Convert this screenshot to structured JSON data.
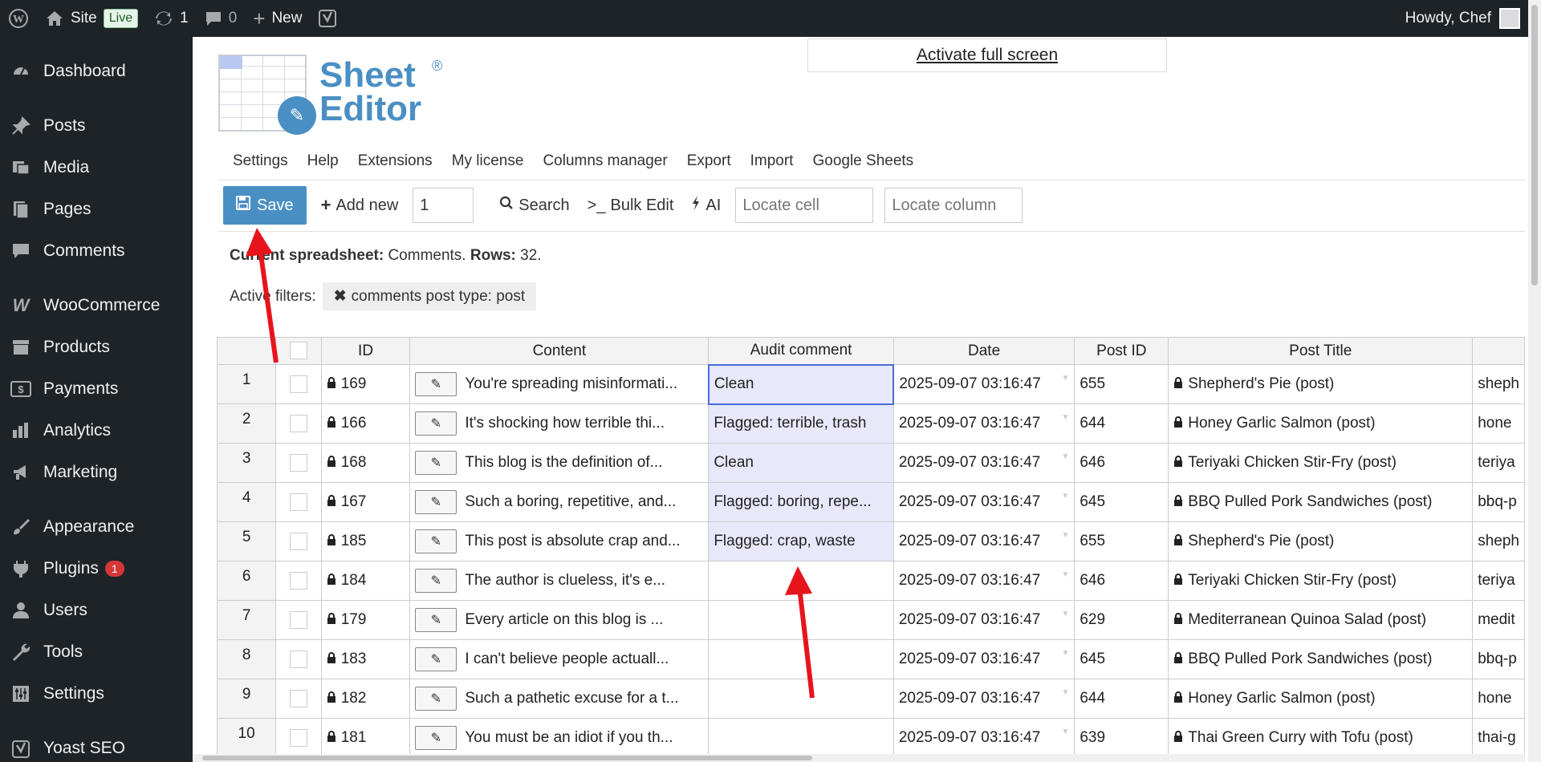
{
  "adminbar": {
    "site_label": "Site",
    "live_label": "Live",
    "updates_count": "1",
    "comments_count": "0",
    "new_label": "New",
    "howdy": "Howdy, Chef"
  },
  "sidebar": {
    "items": [
      {
        "label": "Dashboard",
        "icon": "dashboard-icon"
      },
      {
        "label": "Posts",
        "icon": "pin-icon"
      },
      {
        "label": "Media",
        "icon": "media-icon"
      },
      {
        "label": "Pages",
        "icon": "pages-icon"
      },
      {
        "label": "Comments",
        "icon": "comment-icon"
      },
      {
        "label": "WooCommerce",
        "icon": "woo-icon"
      },
      {
        "label": "Products",
        "icon": "archive-icon"
      },
      {
        "label": "Payments",
        "icon": "dollar-icon"
      },
      {
        "label": "Analytics",
        "icon": "bar-chart-icon"
      },
      {
        "label": "Marketing",
        "icon": "megaphone-icon"
      },
      {
        "label": "Appearance",
        "icon": "brush-icon"
      },
      {
        "label": "Plugins",
        "icon": "plug-icon",
        "badge": "1"
      },
      {
        "label": "Users",
        "icon": "user-icon"
      },
      {
        "label": "Tools",
        "icon": "wrench-icon"
      },
      {
        "label": "Settings",
        "icon": "sliders-icon"
      },
      {
        "label": "Yoast SEO",
        "icon": "yoast-icon"
      }
    ]
  },
  "fullscreen_link": "Activate full screen",
  "logo": {
    "line1": "Sheet",
    "line2": "Editor",
    "reg": "®"
  },
  "tabs": [
    "Settings",
    "Help",
    "Extensions",
    "My license",
    "Columns manager",
    "Export",
    "Import",
    "Google Sheets"
  ],
  "toolbar": {
    "save": "Save",
    "add_new": "Add new",
    "add_new_qty": "1",
    "search": "Search",
    "bulk_edit": "Bulk Edit",
    "ai": "AI",
    "locate_cell_placeholder": "Locate cell",
    "locate_column_placeholder": "Locate column"
  },
  "sheet_info": {
    "current_label": "Current spreadsheet:",
    "current_value": "Comments.",
    "rows_label": "Rows:",
    "rows_value": "32."
  },
  "filters": {
    "label": "Active filters:",
    "chip": "comments post type: post"
  },
  "table": {
    "headers": [
      "ID",
      "Content",
      "Audit comment",
      "Date",
      "Post ID",
      "Post Title"
    ],
    "rows": [
      {
        "n": "1",
        "id": "169",
        "content": "You're spreading misinformati...",
        "audit": "Clean",
        "date": "2025-09-07 03:16:47",
        "post_id": "655",
        "title": "Shepherd's Pie (post)",
        "slug": "sheph"
      },
      {
        "n": "2",
        "id": "166",
        "content": "It's shocking how terrible thi...",
        "audit": "Flagged: terrible, trash",
        "date": "2025-09-07 03:16:47",
        "post_id": "644",
        "title": "Honey Garlic Salmon (post)",
        "slug": "hone"
      },
      {
        "n": "3",
        "id": "168",
        "content": "This blog is the definition of...",
        "audit": "Clean",
        "date": "2025-09-07 03:16:47",
        "post_id": "646",
        "title": "Teriyaki Chicken Stir-Fry (post)",
        "slug": "teriya"
      },
      {
        "n": "4",
        "id": "167",
        "content": "Such a boring, repetitive, and...",
        "audit": "Flagged: boring, repe...",
        "date": "2025-09-07 03:16:47",
        "post_id": "645",
        "title": "BBQ Pulled Pork Sandwiches (post)",
        "slug": "bbq-p"
      },
      {
        "n": "5",
        "id": "185",
        "content": "This post is absolute crap and...",
        "audit": "Flagged: crap, waste",
        "date": "2025-09-07 03:16:47",
        "post_id": "655",
        "title": "Shepherd's Pie (post)",
        "slug": "sheph"
      },
      {
        "n": "6",
        "id": "184",
        "content": "The author is clueless, it's e...",
        "audit": "",
        "date": "2025-09-07 03:16:47",
        "post_id": "646",
        "title": "Teriyaki Chicken Stir-Fry (post)",
        "slug": "teriya"
      },
      {
        "n": "7",
        "id": "179",
        "content": "Every article on this blog is ...",
        "audit": "",
        "date": "2025-09-07 03:16:47",
        "post_id": "629",
        "title": "Mediterranean Quinoa Salad (post)",
        "slug": "medit"
      },
      {
        "n": "8",
        "id": "183",
        "content": "I can't believe people actuall...",
        "audit": "",
        "date": "2025-09-07 03:16:47",
        "post_id": "645",
        "title": "BBQ Pulled Pork Sandwiches (post)",
        "slug": "bbq-p"
      },
      {
        "n": "9",
        "id": "182",
        "content": "Such a pathetic excuse for a t...",
        "audit": "",
        "date": "2025-09-07 03:16:47",
        "post_id": "644",
        "title": "Honey Garlic Salmon (post)",
        "slug": "hone"
      },
      {
        "n": "10",
        "id": "181",
        "content": "You must be an idiot if you th...",
        "audit": "",
        "date": "2025-09-07 03:16:47",
        "post_id": "639",
        "title": "Thai Green Curry with Tofu (post)",
        "slug": "thai-g"
      }
    ]
  },
  "colors": {
    "accent": "#4a8fc4",
    "adminbar": "#1d2327",
    "selection": "#e8e8fb",
    "arrow": "#e8141c"
  }
}
